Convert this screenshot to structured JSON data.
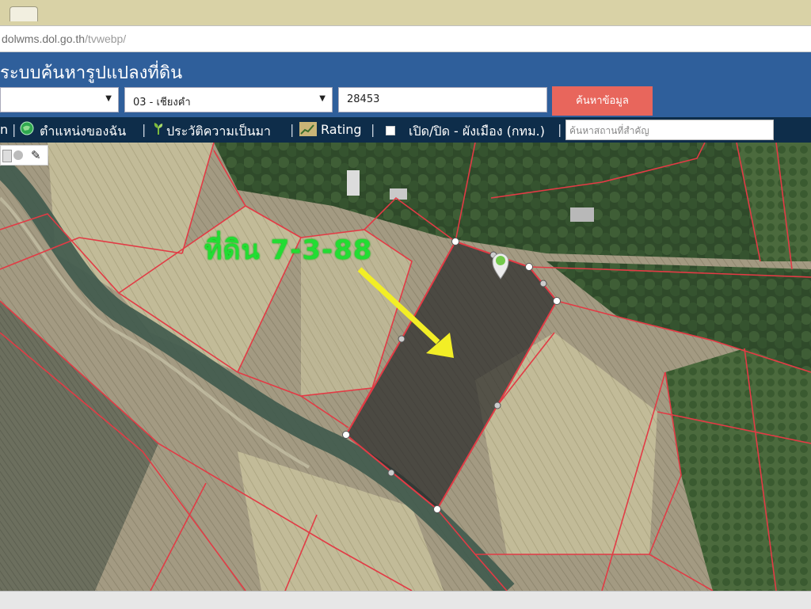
{
  "browser": {
    "url_main": "dolwms.dol.go.th",
    "url_path": "/tvwebp/"
  },
  "app": {
    "title": "ระบบค้นหารูปแปลงที่ดิน"
  },
  "search": {
    "district_value": "03 - เชียงคำ",
    "parcel_value": "28453",
    "button_label": "ค้นหาข้อมูล"
  },
  "toolbar": {
    "item_first": "n",
    "my_location": "ตำแหน่งของฉัน",
    "history": "ประวัติความเป็นมา",
    "rating": "Rating",
    "city_plan": "เปิด/ปิด - ผังเมือง (กทม.)",
    "place_placeholder": "ค้นหาสถานที่สำคัญ"
  },
  "map": {
    "annotation": "ที่ดิน 7-3-88",
    "boundary_color": "#e23b45",
    "annotation_color": "#22dd33",
    "arrow_color": "#f2ee26"
  }
}
